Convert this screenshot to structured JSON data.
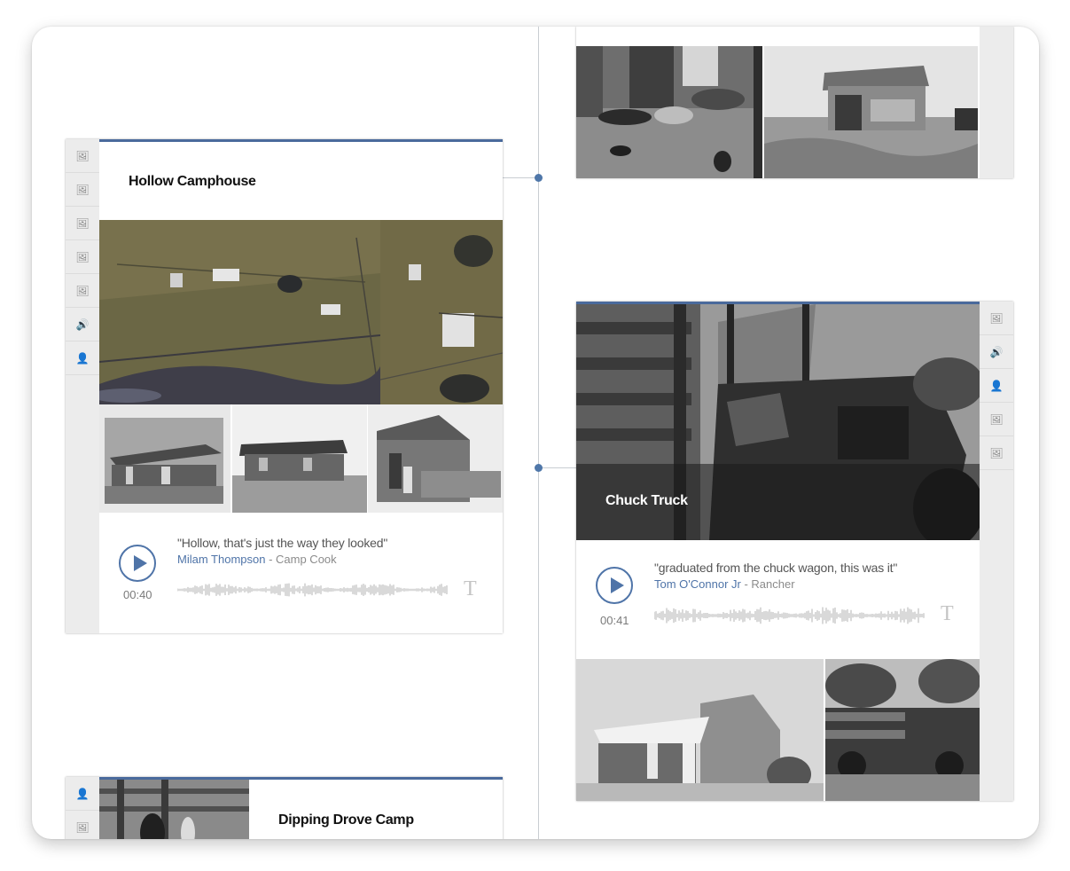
{
  "cards": {
    "hollow": {
      "title": "Hollow Camphouse",
      "rail_icons": [
        "image-icon",
        "image-icon",
        "image-icon",
        "image-icon",
        "image-icon",
        "audio-icon",
        "person-icon"
      ],
      "audio": {
        "quote": "\"Hollow, that's just the way they looked\"",
        "speaker": "Milam Thompson",
        "role": " - Camp Cook",
        "duration": "00:40",
        "transcript_label": "T"
      }
    },
    "chuck": {
      "title": "Chuck Truck",
      "rail_icons": [
        "image-icon",
        "audio-icon",
        "person-icon",
        "image-icon",
        "image-icon"
      ],
      "audio": {
        "quote": "\"graduated from the chuck wagon, this was it\"",
        "speaker": "Tom O'Connor Jr",
        "role": " - Rancher",
        "duration": "00:41",
        "transcript_label": "T"
      }
    },
    "dipping": {
      "title": "Dipping Drove Camp",
      "rail_icons": [
        "person-icon",
        "image-icon"
      ]
    }
  },
  "colors": {
    "accent": "#4f74a8",
    "card_topbar": "#4a6a9c",
    "rail": "#ececec",
    "timeline": "#c9cdd2"
  }
}
